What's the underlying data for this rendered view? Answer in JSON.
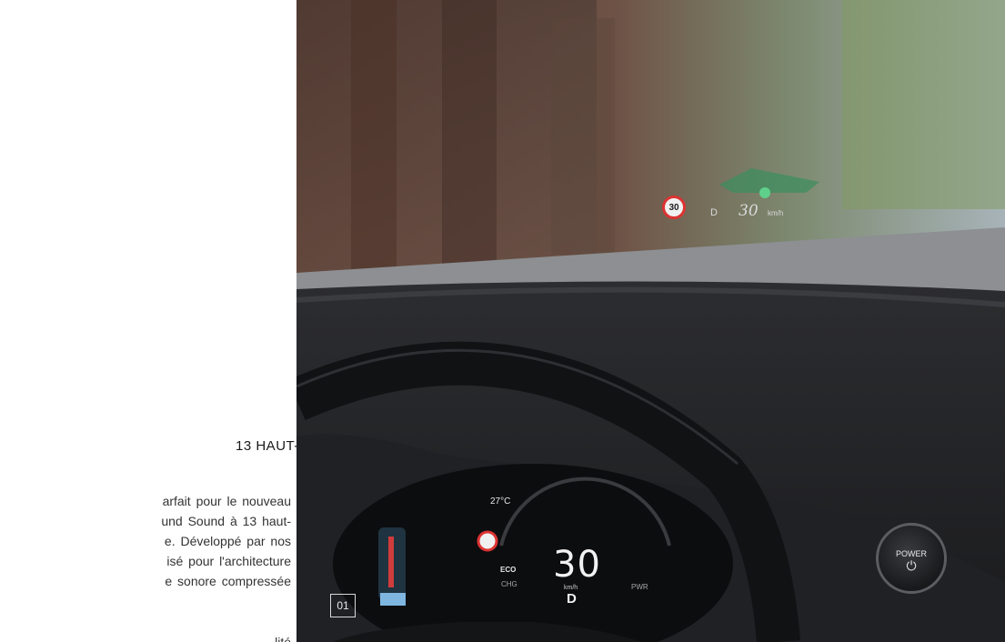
{
  "article": {
    "heading": "13 HAUT-",
    "body_lines": [
      "arfait pour le nouveau",
      "und Sound à 13 haut-",
      "e. Développé par nos",
      "isé pour l'architecture",
      "e sonore compressée",
      "lité"
    ]
  },
  "photo": {
    "index_badge": "01",
    "cluster": {
      "speed": "30",
      "unit": "km/h",
      "gear": "D",
      "temperature": "27°C",
      "mode_eco": "ECO",
      "mode_chg": "CHG",
      "mode_pwr": "PWR"
    },
    "power_button": {
      "label": "POWER",
      "symbol": "⏻"
    },
    "hud": {
      "speed_limit": "30",
      "gear": "D",
      "speed": "30",
      "unit": "km/h"
    }
  }
}
